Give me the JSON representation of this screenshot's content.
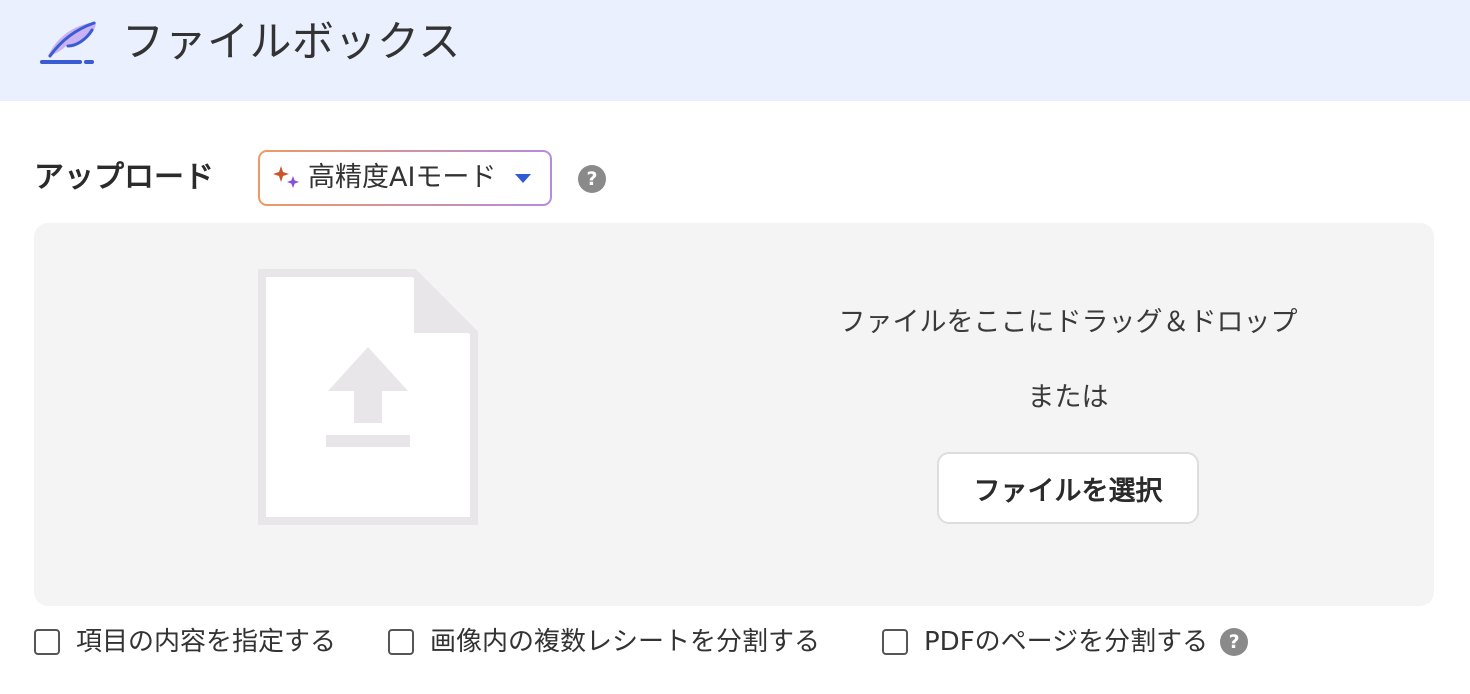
{
  "header": {
    "app_title": "ファイルボックス",
    "background_color": "#eaf0fd",
    "logo_icon": "quill-pen-icon"
  },
  "upload": {
    "label": "アップロード",
    "mode_select": {
      "selected": "高精度AIモード",
      "icon": "sparkle-icon",
      "border_gradient": [
        "#ee9a63",
        "#b38be0"
      ],
      "caret_color": "#2f5bd3"
    },
    "help": "?"
  },
  "dropzone": {
    "drop_text": "ファイルをここにドラッグ＆ドロップ",
    "or_text": "または",
    "select_button": "ファイルを選択",
    "illustration_icon": "file-upload-icon",
    "background_color": "#f5f4f5"
  },
  "options": [
    {
      "label": "項目の内容を指定する",
      "checked": false
    },
    {
      "label": "画像内の複数レシートを分割する",
      "checked": false
    },
    {
      "label": "PDFのページを分割する",
      "checked": false,
      "help": "?"
    }
  ]
}
